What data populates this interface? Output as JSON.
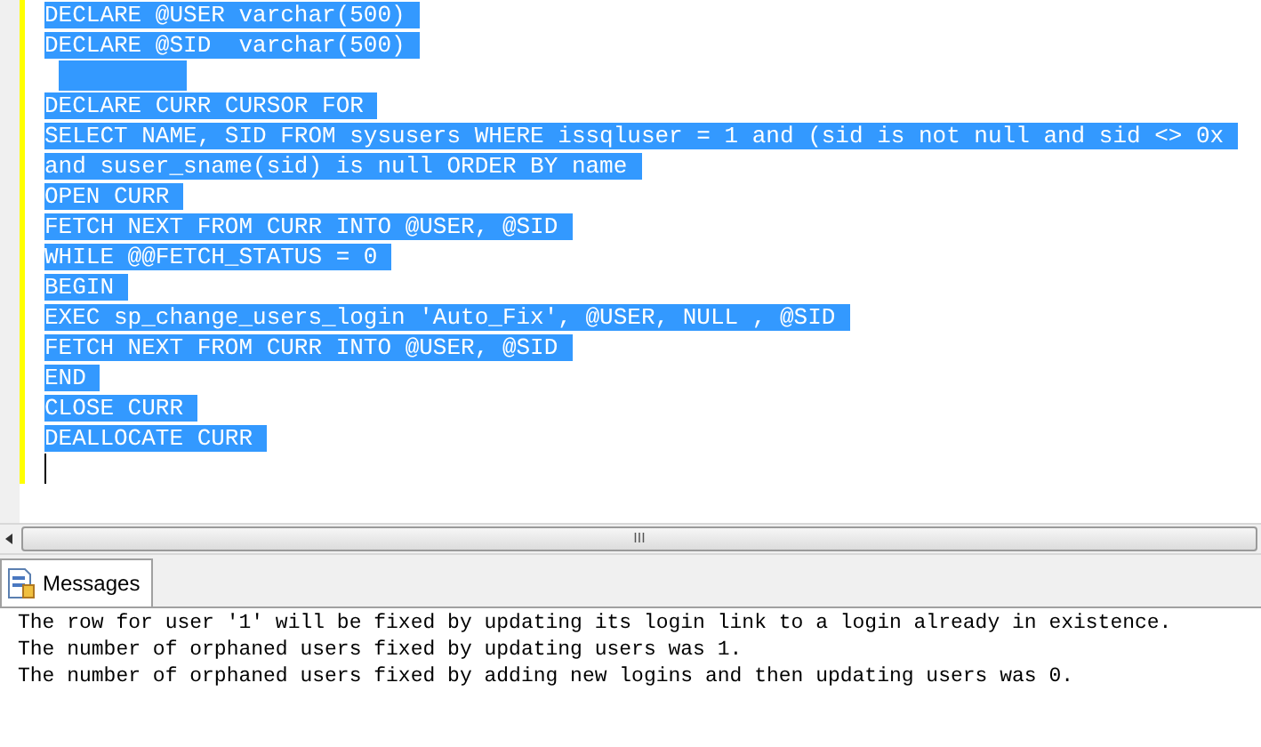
{
  "editor": {
    "lines": [
      {
        "kind": "code",
        "text": "DECLARE @USER varchar(500)"
      },
      {
        "kind": "code",
        "text": "DECLARE @SID  varchar(500)"
      },
      {
        "kind": "blank"
      },
      {
        "kind": "code",
        "text": "DECLARE CURR CURSOR FOR"
      },
      {
        "kind": "code",
        "text": "SELECT NAME, SID FROM sysusers WHERE issqluser = 1 and (sid is not null and sid <> 0x"
      },
      {
        "kind": "code",
        "text": "and suser_sname(sid) is null ORDER BY name"
      },
      {
        "kind": "code",
        "text": "OPEN CURR"
      },
      {
        "kind": "code",
        "text": "FETCH NEXT FROM CURR INTO @USER, @SID"
      },
      {
        "kind": "code",
        "text": "WHILE @@FETCH_STATUS = 0"
      },
      {
        "kind": "code",
        "text": "BEGIN"
      },
      {
        "kind": "code",
        "text": "EXEC sp_change_users_login 'Auto_Fix', @USER, NULL , @SID"
      },
      {
        "kind": "code",
        "text": "FETCH NEXT FROM CURR INTO @USER, @SID"
      },
      {
        "kind": "code",
        "text": "END"
      },
      {
        "kind": "code",
        "text": "CLOSE CURR"
      },
      {
        "kind": "code",
        "text": "DEALLOCATE CURR"
      }
    ],
    "selected": true,
    "grip": "III"
  },
  "tabs": [
    {
      "label": "Messages",
      "selected": true
    }
  ],
  "messages": [
    "The row for user '1' will be fixed by updating its login link to a login already in existence.",
    "The number of orphaned users fixed by updating users was 1.",
    "The number of orphaned users fixed by adding new logins and then updating users was 0."
  ]
}
